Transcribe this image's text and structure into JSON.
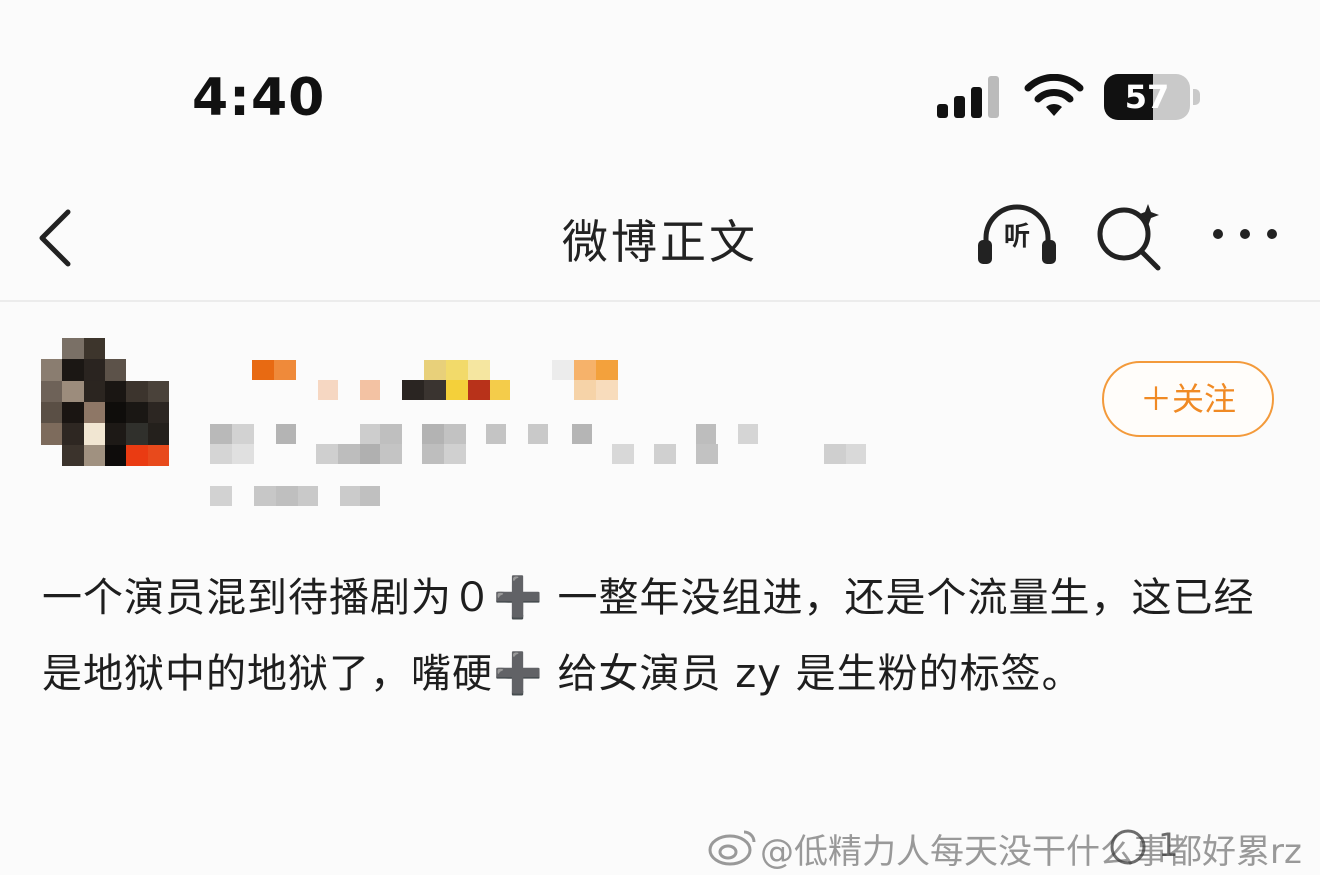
{
  "status_bar": {
    "time": "4:40",
    "battery_percent": "57",
    "battery_level": 0.57
  },
  "nav": {
    "title": "微博正文",
    "listen_label": "听",
    "icons": [
      "back-chevron-icon",
      "headphones-icon",
      "search-sparkle-icon",
      "more-dots-icon"
    ]
  },
  "post": {
    "follow_label": "＋关注",
    "text": "一个演员混到待播剧为０➕ 一整年没组进，还是个流量生，这已经是地狱中的地狱了，嘴硬➕ 给女演员 zy 是生粉的标签。"
  },
  "footer": {
    "watermark": "@低精力人每天没干什么事都好累",
    "watermark_suffix": "rz",
    "reply_count": "1"
  },
  "colors": {
    "accent": "#f08a24",
    "background": "#fbfbfb",
    "text": "#1e1e1e"
  }
}
